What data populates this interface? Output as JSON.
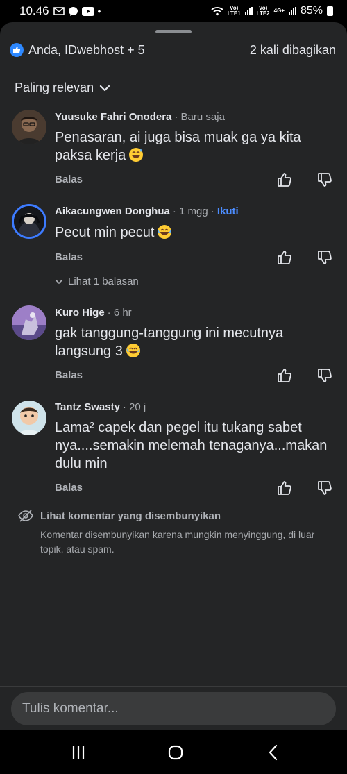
{
  "status_bar": {
    "time": "10.46",
    "dot": "•",
    "sim1_label_top": "Vo)",
    "sim1_label_bottom": "LTE1",
    "sim2_label_top": "Vo)",
    "sim2_label_bottom": "LTE2",
    "network": "4G+",
    "battery": "85%",
    "icons": [
      "gmail-icon",
      "messenger-icon",
      "youtube-icon",
      "wifi-icon",
      "signal-icon",
      "battery-icon"
    ]
  },
  "reactions": {
    "names": "Anda, IDwebhost + 5",
    "shares": "2 kali dibagikan"
  },
  "sort": {
    "label": "Paling relevan"
  },
  "comments": [
    {
      "author": "Yuusuke Fahri Onodera",
      "time": "· Baru saja",
      "follow": "",
      "text": "Penasaran, ai juga bisa muak ga ya kita paksa kerja",
      "emoji": "sweat-smile",
      "reply": "Balas"
    },
    {
      "author": "Aikacungwen Donghua",
      "time": "· 1 mgg ·",
      "follow": "Ikuti",
      "text": "Pecut min pecut",
      "emoji": "tears-of-joy",
      "reply": "Balas",
      "replies": "Lihat 1 balasan"
    },
    {
      "author": "Kuro Hige",
      "time": "· 6 hr",
      "follow": "",
      "text": "gak tanggung-tanggung ini mecutnya langsung 3",
      "emoji": "tears-of-joy",
      "reply": "Balas"
    },
    {
      "author": "Tantz Swasty",
      "time": "· 20 j",
      "follow": "",
      "text": "Lama² capek dan pegel itu tukang sabet nya....semakin melemah tenaganya...makan dulu min",
      "emoji": "",
      "reply": "Balas"
    }
  ],
  "hidden": {
    "title": "Lihat komentar yang disembunyikan",
    "desc": "Komentar disembunyikan karena mungkin menyinggung, di luar topik, atau spam."
  },
  "composer": {
    "placeholder": "Tulis komentar..."
  },
  "colors": {
    "sheet": "#242526",
    "accent": "#2d88ff",
    "follow": "#4c8dff",
    "text": "#e4e6eb",
    "muted": "#b0b3b8"
  }
}
